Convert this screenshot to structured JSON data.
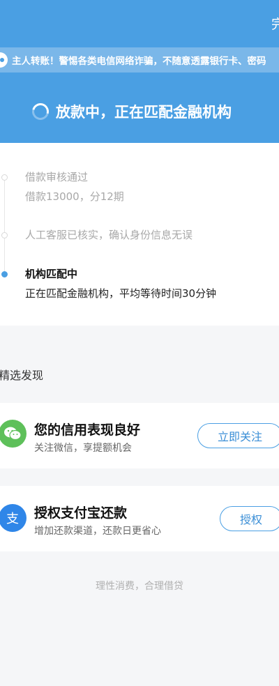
{
  "header": {
    "done_label": "完",
    "notice_text": "主人转账！警惕各类电信网络诈骗，不随意透露银行卡、密码",
    "status_text": "放款中，正在匹配金融机构",
    "colors": {
      "primary": "#4a9fe3",
      "notice_bg": "#7ab7e9"
    }
  },
  "timeline": {
    "steps": [
      {
        "title": "借款审核通过",
        "subtitle": "借款13000，分12期",
        "state": "done"
      },
      {
        "title": "人工客服已核实，确认身份信息无误",
        "state": "done"
      },
      {
        "title": "机构匹配中",
        "subtitle": "正在匹配金融机构，平均等待时间30分钟",
        "state": "active"
      }
    ]
  },
  "discover": {
    "section_title": "精选发现",
    "cards": [
      {
        "icon": "wechat-icon",
        "title": "您的信用表现良好",
        "subtitle": "关注微信，享提额机会",
        "button": "立即关注"
      },
      {
        "icon": "alipay-icon",
        "title": "授权支付宝还款",
        "subtitle": "增加还款渠道，还款日更省心",
        "button": "授权",
        "icon_glyph": "支"
      }
    ]
  },
  "footer": {
    "note": "理性消费，合理借贷"
  }
}
